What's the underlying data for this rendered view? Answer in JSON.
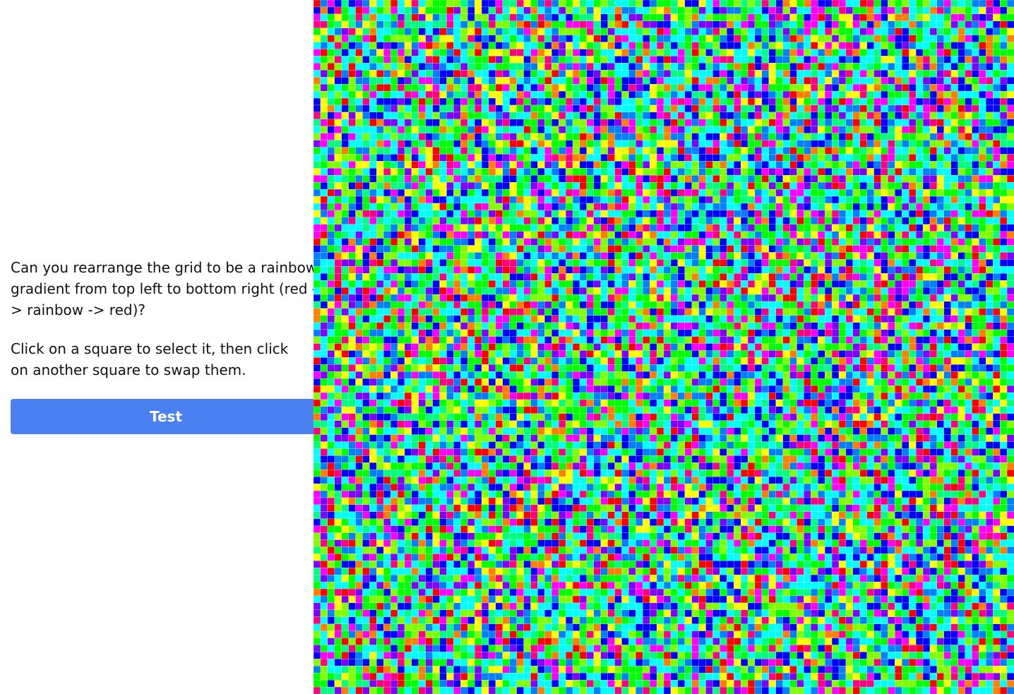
{
  "instructions": {
    "line1": "Can you rearrange the grid to be a rainbow gradient from top left to bottom right (red -> rainbow -> red)?",
    "line2": "Click on a square to select it, then click on another square to swap them."
  },
  "buttons": {
    "test_label": "Test"
  },
  "grid": {
    "columns": 100,
    "rows": 99,
    "palette": [
      "#ff0000",
      "#ff8000",
      "#ffff00",
      "#80ff00",
      "#00ff00",
      "#00ff80",
      "#00ffff",
      "#0080ff",
      "#0000ff",
      "#8000ff",
      "#ff00ff",
      "#ff0080"
    ],
    "gridline_color": "#e8e8e8"
  }
}
